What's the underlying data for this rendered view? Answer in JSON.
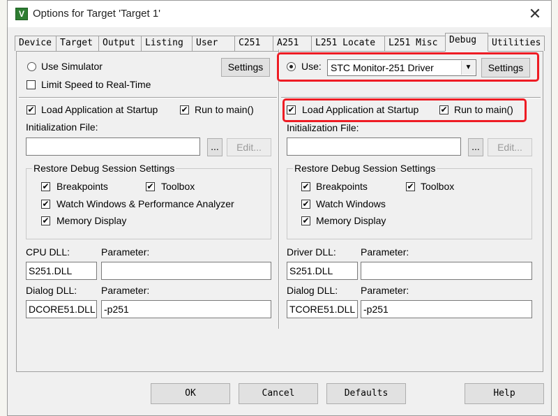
{
  "window": {
    "title": "Options for Target 'Target 1'",
    "close_glyph": "✕"
  },
  "tabs": [
    {
      "label": "Device"
    },
    {
      "label": "Target"
    },
    {
      "label": "Output"
    },
    {
      "label": "Listing"
    },
    {
      "label": "User"
    },
    {
      "label": "C251"
    },
    {
      "label": "A251"
    },
    {
      "label": "L251 Locate"
    },
    {
      "label": "L251 Misc"
    },
    {
      "label": "Debug",
      "active": true
    },
    {
      "label": "Utilities"
    }
  ],
  "left": {
    "use_simulator": "Use Simulator",
    "settings": "Settings",
    "limit_speed": "Limit Speed to Real-Time",
    "load_app": "Load Application at Startup",
    "run_to_main": "Run to main()",
    "init_file": "Initialization File:",
    "browse": "...",
    "edit": "Edit...",
    "restore_title": "Restore Debug Session Settings",
    "breakpoints": "Breakpoints",
    "toolbox": "Toolbox",
    "watch": "Watch Windows & Performance Analyzer",
    "memory": "Memory Display",
    "cpu_dll_label": "CPU DLL:",
    "cpu_param_label": "Parameter:",
    "cpu_dll_value": "S251.DLL",
    "cpu_param_value": "",
    "dialog_dll_label": "Dialog DLL:",
    "dialog_param_label": "Parameter:",
    "dialog_dll_value": "DCORE51.DLL",
    "dialog_param_value": "-p251"
  },
  "right": {
    "use": "Use:",
    "driver_selected": "STC Monitor-251 Driver",
    "settings": "Settings",
    "load_app": "Load Application at Startup",
    "run_to_main": "Run to main()",
    "init_file": "Initialization File:",
    "browse": "...",
    "edit": "Edit...",
    "restore_title": "Restore Debug Session Settings",
    "breakpoints": "Breakpoints",
    "toolbox": "Toolbox",
    "watch": "Watch Windows",
    "memory": "Memory Display",
    "driver_dll_label": "Driver DLL:",
    "driver_param_label": "Parameter:",
    "driver_dll_value": "S251.DLL",
    "driver_param_value": "",
    "dialog_dll_label": "Dialog DLL:",
    "dialog_param_label": "Parameter:",
    "dialog_dll_value": "TCORE51.DLL",
    "dialog_param_value": "-p251"
  },
  "footer": {
    "ok": "OK",
    "cancel": "Cancel",
    "defaults": "Defaults",
    "help": "Help"
  },
  "checkmark": "✔",
  "colors": {
    "highlight": "#ee1c24",
    "dialog_bg": "#f0f0f0",
    "app_icon": "#2e7d32"
  }
}
